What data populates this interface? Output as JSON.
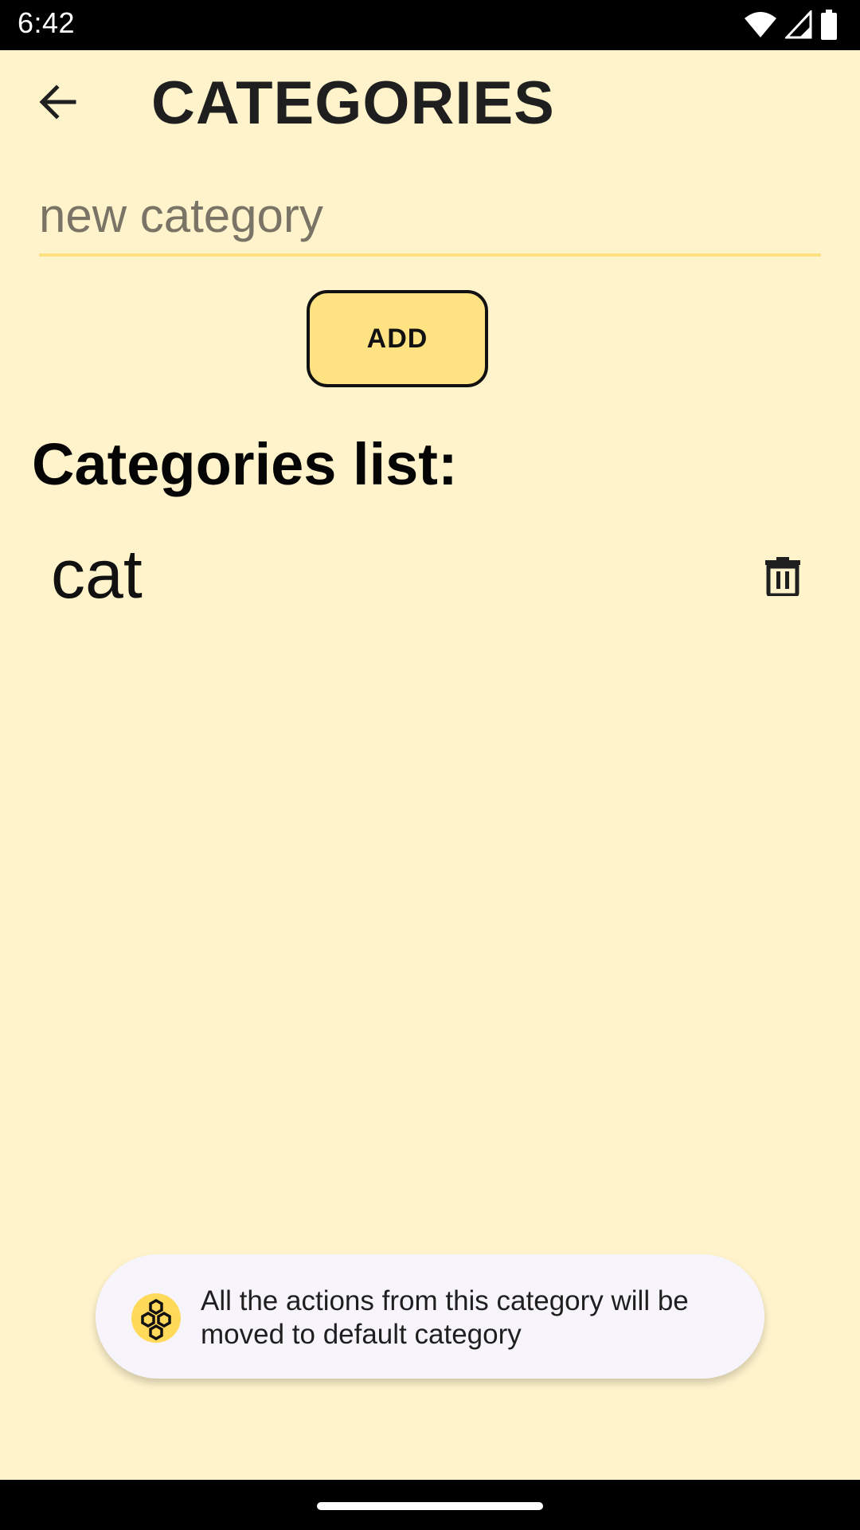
{
  "status_bar": {
    "time": "6:42",
    "icons": [
      "wifi-icon",
      "cellular-icon",
      "battery-icon"
    ]
  },
  "header": {
    "back_icon": "arrow-left-icon",
    "title": "CATEGORIES"
  },
  "new_category": {
    "value": "",
    "placeholder": "new category"
  },
  "add_button": {
    "label": "ADD"
  },
  "list": {
    "title": "Categories list:",
    "items": [
      {
        "label": "cat",
        "delete_icon": "trash-icon"
      }
    ]
  },
  "toast": {
    "icon": "app-honeycomb-icon",
    "message": "All the actions from this category will be moved to default category"
  },
  "colors": {
    "background": "#FFF3CC",
    "accent": "#FFE383",
    "input_underline": "#FFE080"
  }
}
